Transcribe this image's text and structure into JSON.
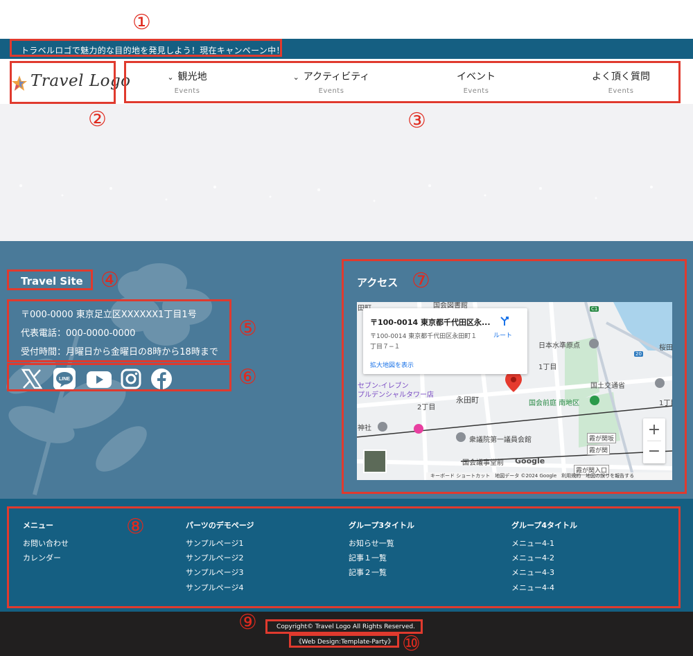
{
  "annotations": {
    "m1": "①",
    "m2": "②",
    "m3": "③",
    "m4": "④",
    "m5": "⑤",
    "m6": "⑥",
    "m7": "⑦",
    "m8": "⑧",
    "m9": "⑨",
    "m10": "⑩"
  },
  "top_bar": {
    "text": "トラベルロゴで魅力的な目的地を発見しよう！現在キャンペーン中！"
  },
  "header": {
    "logo_text": "Travel Logo",
    "nav": [
      {
        "label": "観光地",
        "sub": "Events",
        "has_dropdown": true
      },
      {
        "label": "アクティビティ",
        "sub": "Events",
        "has_dropdown": true
      },
      {
        "label": "イベント",
        "sub": "Events",
        "has_dropdown": false
      },
      {
        "label": "よく頂く質問",
        "sub": "Events",
        "has_dropdown": false
      }
    ]
  },
  "footer_info": {
    "site_name": "Travel Site",
    "address": "〒000-0000 東京足立区XXXXXX1丁目1号",
    "phone": "代表電話：000-0000-0000",
    "hours": "受付時間：月曜日から金曜日の8時から18時まで",
    "sns_icons": [
      "x-icon",
      "line-icon",
      "youtube-icon",
      "instagram-icon",
      "facebook-icon"
    ]
  },
  "access": {
    "title": "アクセス",
    "map": {
      "card_title": "〒100-0014 東京都千代田区永...",
      "card_address_line1": "〒100-0014 東京都千代田区永田町１",
      "card_address_line2": "丁目７−１",
      "route_label": "ルート",
      "enlarge_label": "拡大地図を表示",
      "zoom_in": "+",
      "zoom_out": "−",
      "labels": {
        "l1": "永田町",
        "l2": "日本水準原点",
        "l3": "国土交通省",
        "l4": "国会前庭 南地区",
        "l5": "衆議院第一議員会館",
        "l6": "国会議事堂前",
        "l7": "セブン-イレブン",
        "l8": "プルデンシャルタワー店",
        "l9": "1丁目",
        "l10": "2丁目",
        "l11": "霞が関坂",
        "l12": "霞が関",
        "l13": "霞が関入口",
        "l14": "神社",
        "l15": "桜田",
        "l16": "1丁目",
        "l17": "20",
        "l18": "C1",
        "l19": "田町",
        "l20": "国会図書館"
      },
      "attribution": "キーボード ショートカット　地図データ ©2024 Google　利用規約　地図の誤りを報告する",
      "google": "Google"
    }
  },
  "footer_menu": {
    "columns": [
      {
        "title": "メニュー",
        "items": [
          "お問い合わせ",
          "カレンダー"
        ]
      },
      {
        "title": "パーツのデモページ",
        "items": [
          "サンプルページ1",
          "サンプルページ2",
          "サンプルページ3",
          "サンプルページ4"
        ]
      },
      {
        "title": "グループ3タイトル",
        "items": [
          "お知らせ一覧",
          "記事１一覧",
          "記事２一覧"
        ]
      },
      {
        "title": "グループ4タイトル",
        "items": [
          "メニュー4-1",
          "メニュー4-2",
          "メニュー4-3",
          "メニュー4-4"
        ]
      }
    ]
  },
  "bottom": {
    "copyright": "Copyright© Travel Logo All Rights Reserved.",
    "web_design": "《Web Design:Template-Party》"
  },
  "colors": {
    "top_bar": "#155f82",
    "footer_upper": "#4a7a99",
    "footer_menu": "#155f82",
    "bottom_bar": "#211f1f",
    "annotation": "#e03a2e"
  }
}
